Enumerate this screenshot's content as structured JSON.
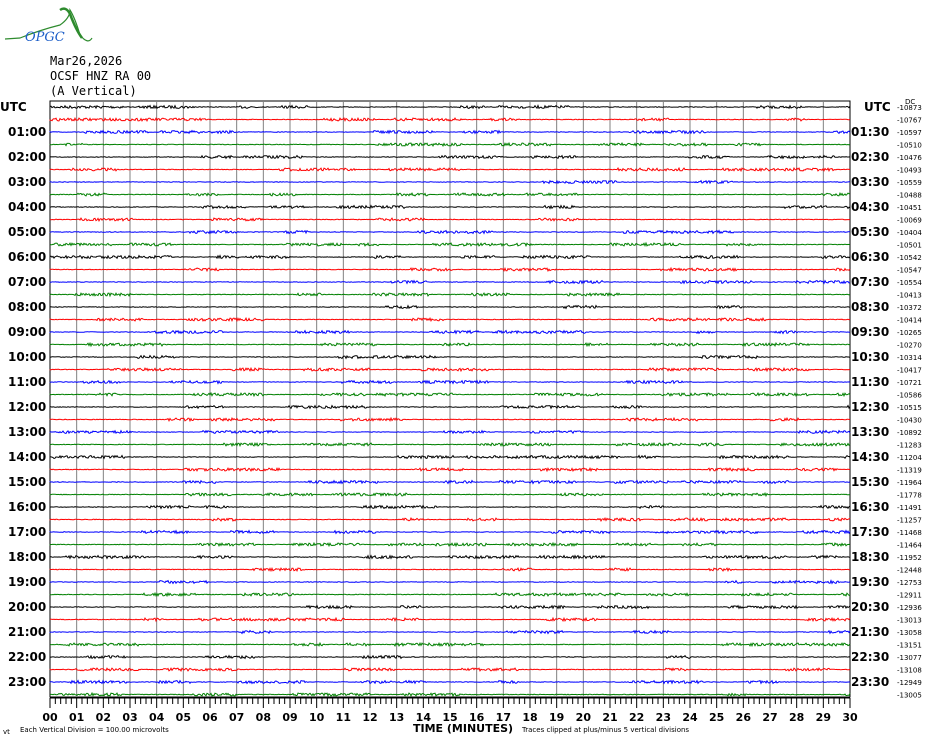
{
  "header": {
    "logo_text": "OPGC",
    "date": "Mar26,2026",
    "station": "OCSF HNZ RA 00",
    "component": "(A Vertical)",
    "utc_left": "UTC",
    "utc_right": "UTC",
    "dc_label": "DC"
  },
  "footer": {
    "scale_note": "Each Vertical Division =  100.00 microvolts",
    "xlabel": "TIME (MINUTES)",
    "clip_note": "Traces clipped at plus/minus 5 vertical divisions"
  },
  "chart_data": {
    "type": "line",
    "xlabel": "TIME (MINUTES)",
    "xlim": [
      0,
      30
    ],
    "x_tick_labels": [
      "00",
      "01",
      "02",
      "03",
      "04",
      "05",
      "06",
      "07",
      "08",
      "09",
      "10",
      "11",
      "12",
      "13",
      "14",
      "15",
      "16",
      "17",
      "18",
      "19",
      "20",
      "21",
      "22",
      "23",
      "24",
      "25",
      "26",
      "27",
      "28",
      "29",
      "30"
    ],
    "grid": true,
    "trace_colors": [
      "#000000",
      "#ff0000",
      "#0000ff",
      "#008000"
    ],
    "left_labels": [
      "UTC",
      "01:00",
      "02:00",
      "03:00",
      "04:00",
      "05:00",
      "06:00",
      "07:00",
      "08:00",
      "09:00",
      "10:00",
      "11:00",
      "12:00",
      "13:00",
      "14:00",
      "15:00",
      "16:00",
      "17:00",
      "18:00",
      "19:00",
      "20:00",
      "21:00",
      "22:00",
      "23:00"
    ],
    "right_labels": [
      "UTC",
      "01:30",
      "02:30",
      "03:30",
      "04:30",
      "05:30",
      "06:30",
      "07:30",
      "08:30",
      "09:30",
      "10:30",
      "11:30",
      "12:30",
      "13:30",
      "14:30",
      "15:30",
      "16:30",
      "17:30",
      "18:30",
      "19:30",
      "20:30",
      "21:30",
      "22:30",
      "23:30"
    ],
    "dc_offsets": [
      "-10873",
      "-10767",
      "-10597",
      "-10510",
      "-10476",
      "-10493",
      "-10559",
      "-10488",
      "-10451",
      "-10069",
      "-10404",
      "-10501",
      "-10542",
      "-10547",
      "-10554",
      "-10413",
      "-10372",
      "-10414",
      "-10265",
      "-10270",
      "-10314",
      "-10417",
      "-10721",
      "-10586",
      "-10515",
      "-10430",
      "-10892",
      "-11283",
      "-11204",
      "-11319",
      "-11964",
      "-11778",
      "-11491",
      "-11257",
      "-11468",
      "-11464",
      "-11952",
      "-12448",
      "-12753",
      "-12911",
      "-12936",
      "-13013",
      "-13058",
      "-13151",
      "-13077",
      "-13108",
      "-12949",
      "-13005"
    ]
  }
}
